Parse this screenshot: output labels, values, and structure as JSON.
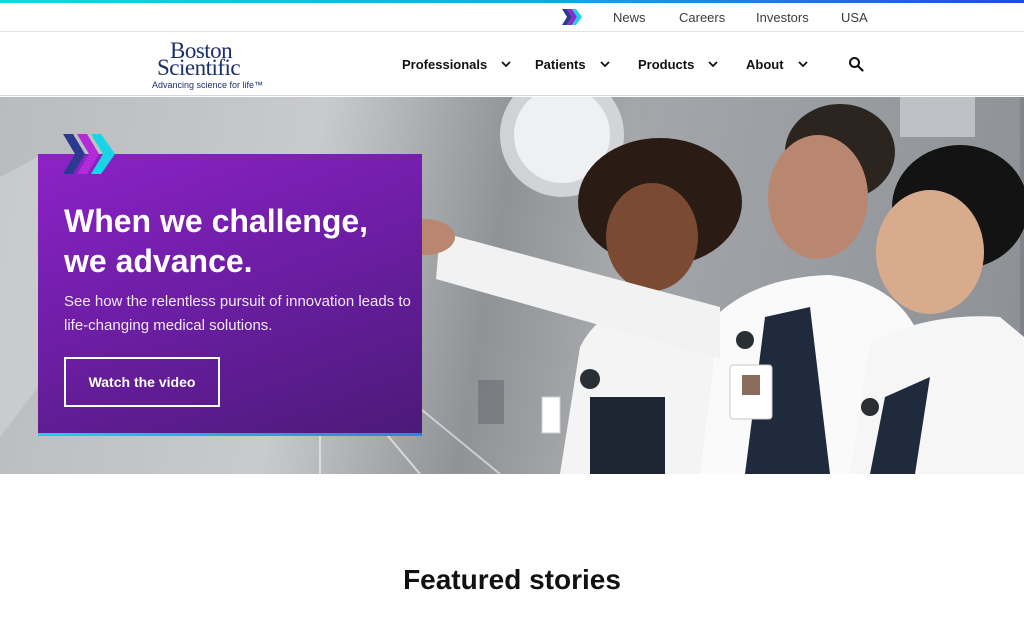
{
  "utility": {
    "links": [
      "News",
      "Careers",
      "Investors",
      "USA"
    ]
  },
  "brand": {
    "name_line1": "Boston",
    "name_line2": "Scientific",
    "tagline": "Advancing science for life™",
    "color": "#1c2e6b"
  },
  "nav": {
    "items": [
      {
        "label": "Professionals",
        "icon": "chevron-down-icon"
      },
      {
        "label": "Patients",
        "icon": "chevron-down-icon"
      },
      {
        "label": "Products",
        "icon": "chevron-down-icon"
      },
      {
        "label": "About",
        "icon": "chevron-down-icon"
      }
    ],
    "search_icon": "search-icon"
  },
  "hero": {
    "title": "When we challenge, we advance.",
    "description": "See how the relentless pursuit of innovation leads to life-changing medical solutions.",
    "cta_label": "Watch the video",
    "card_color": "#6e1ea6",
    "accent_color": "#19d3e6"
  },
  "featured": {
    "title": "Featured stories"
  }
}
